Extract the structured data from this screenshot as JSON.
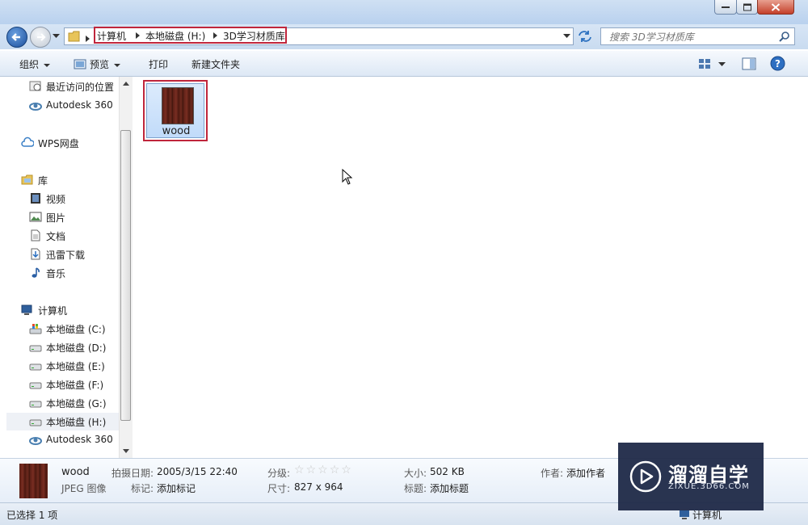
{
  "window": {
    "controls": {
      "minimize_icon": "minimize-icon",
      "maximize_icon": "maximize-icon",
      "close_icon": "close-icon"
    }
  },
  "address": {
    "crumbs": [
      "计算机",
      "本地磁盘 (H:)",
      "3D学习材质库"
    ]
  },
  "search": {
    "placeholder": "搜索 3D学习材质库"
  },
  "toolbar": {
    "organize": "组织",
    "preview": "预览",
    "print": "打印",
    "new_folder": "新建文件夹"
  },
  "nav": {
    "items": [
      {
        "label": "最近访问的位置",
        "icon": "recent-places-icon"
      },
      {
        "label": "Autodesk 360",
        "icon": "autodesk-360-icon"
      },
      {
        "label": "WPS网盘",
        "icon": "cloud-icon"
      },
      {
        "label": "库",
        "icon": "library-icon"
      },
      {
        "label": "视频",
        "icon": "video-icon"
      },
      {
        "label": "图片",
        "icon": "pictures-icon"
      },
      {
        "label": "文档",
        "icon": "documents-icon"
      },
      {
        "label": "迅雷下载",
        "icon": "download-icon"
      },
      {
        "label": "音乐",
        "icon": "music-icon"
      },
      {
        "label": "计算机",
        "icon": "computer-icon"
      },
      {
        "label": "本地磁盘 (C:)",
        "icon": "system-drive-icon"
      },
      {
        "label": "本地磁盘 (D:)",
        "icon": "drive-icon"
      },
      {
        "label": "本地磁盘 (E:)",
        "icon": "drive-icon"
      },
      {
        "label": "本地磁盘 (F:)",
        "icon": "drive-icon"
      },
      {
        "label": "本地磁盘 (G:)",
        "icon": "drive-icon"
      },
      {
        "label": "本地磁盘 (H:)",
        "icon": "drive-icon",
        "selected": true
      },
      {
        "label": "Autodesk 360",
        "icon": "autodesk-360-icon"
      }
    ]
  },
  "files": [
    {
      "name": "wood",
      "type": "JPEG 图像",
      "selected": true
    }
  ],
  "details": {
    "name": "wood",
    "type": "JPEG 图像",
    "date_label": "拍摄日期:",
    "date_value": "2005/3/15 22:40",
    "tags_label": "标记:",
    "tags_value": "添加标记",
    "rating_label": "分级:",
    "rating": 0,
    "rating_max": 5,
    "dims_label": "尺寸:",
    "dims_value": "827 x 964",
    "size_label": "大小:",
    "size_value": "502 KB",
    "title_label": "标题:",
    "title_value": "添加标题",
    "author_label": "作者:",
    "author_value": "添加作者"
  },
  "status": {
    "text": "已选择 1 项",
    "location": "计算机"
  },
  "watermark": {
    "title": "溜溜自学",
    "subtitle": "ZIXUE.3D66.COM"
  },
  "colors": {
    "highlight_border": "#c0263c",
    "selection_fill": "#c1dbfa",
    "watermark_bg": "#1f2a48"
  }
}
